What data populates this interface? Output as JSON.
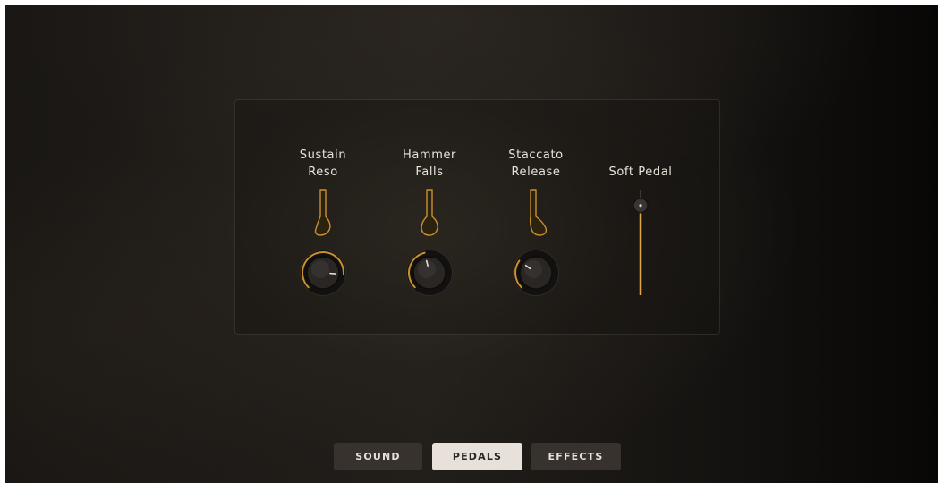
{
  "controls": [
    {
      "label": "Sustain\nReso",
      "type": "knob",
      "value": 0.85
    },
    {
      "label": "Hammer\nFalls",
      "type": "knob",
      "value": 0.45
    },
    {
      "label": "Staccato\nRelease",
      "type": "knob",
      "value": 0.3
    },
    {
      "label": "Soft Pedal",
      "type": "slider",
      "value": 0.85
    }
  ],
  "tabs": {
    "sound": "SOUND",
    "pedals": "PEDALS",
    "effects": "EFFECTS",
    "active": "pedals"
  },
  "colors": {
    "accent": "#c9902f",
    "accent_light": "#e0a84a",
    "knob_body": "#2a2624",
    "tab_active": "#e7e1da",
    "tab_inactive": "#37322e"
  }
}
